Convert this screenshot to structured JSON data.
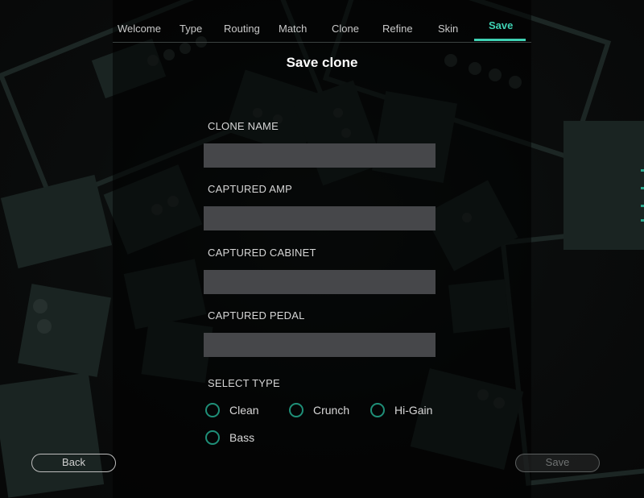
{
  "nav": {
    "steps": [
      {
        "label": "Welcome"
      },
      {
        "label": "Type"
      },
      {
        "label": "Routing"
      },
      {
        "label": "Match"
      },
      {
        "label": "Clone"
      },
      {
        "label": "Refine"
      },
      {
        "label": "Skin"
      },
      {
        "label": "Save"
      }
    ],
    "active_step": "Save"
  },
  "page": {
    "title": "Save clone"
  },
  "form": {
    "clone_name": {
      "label": "CLONE NAME",
      "value": ""
    },
    "captured_amp": {
      "label": "CAPTURED AMP",
      "value": ""
    },
    "captured_cabinet": {
      "label": "CAPTURED CABINET",
      "value": ""
    },
    "captured_pedal": {
      "label": "CAPTURED PEDAL",
      "value": ""
    },
    "select_type": {
      "label": "SELECT TYPE",
      "options": [
        {
          "label": "Clean",
          "selected": false
        },
        {
          "label": "Crunch",
          "selected": false
        },
        {
          "label": "Hi-Gain",
          "selected": false
        },
        {
          "label": "Bass",
          "selected": false
        }
      ]
    }
  },
  "buttons": {
    "back": {
      "label": "Back",
      "enabled": true
    },
    "save": {
      "label": "Save",
      "enabled": false
    }
  },
  "colors": {
    "accent": "#3fd2b4",
    "radio_ring": "#1f8f78",
    "input_bg": "#46474a",
    "background": "#0c0e0e"
  }
}
